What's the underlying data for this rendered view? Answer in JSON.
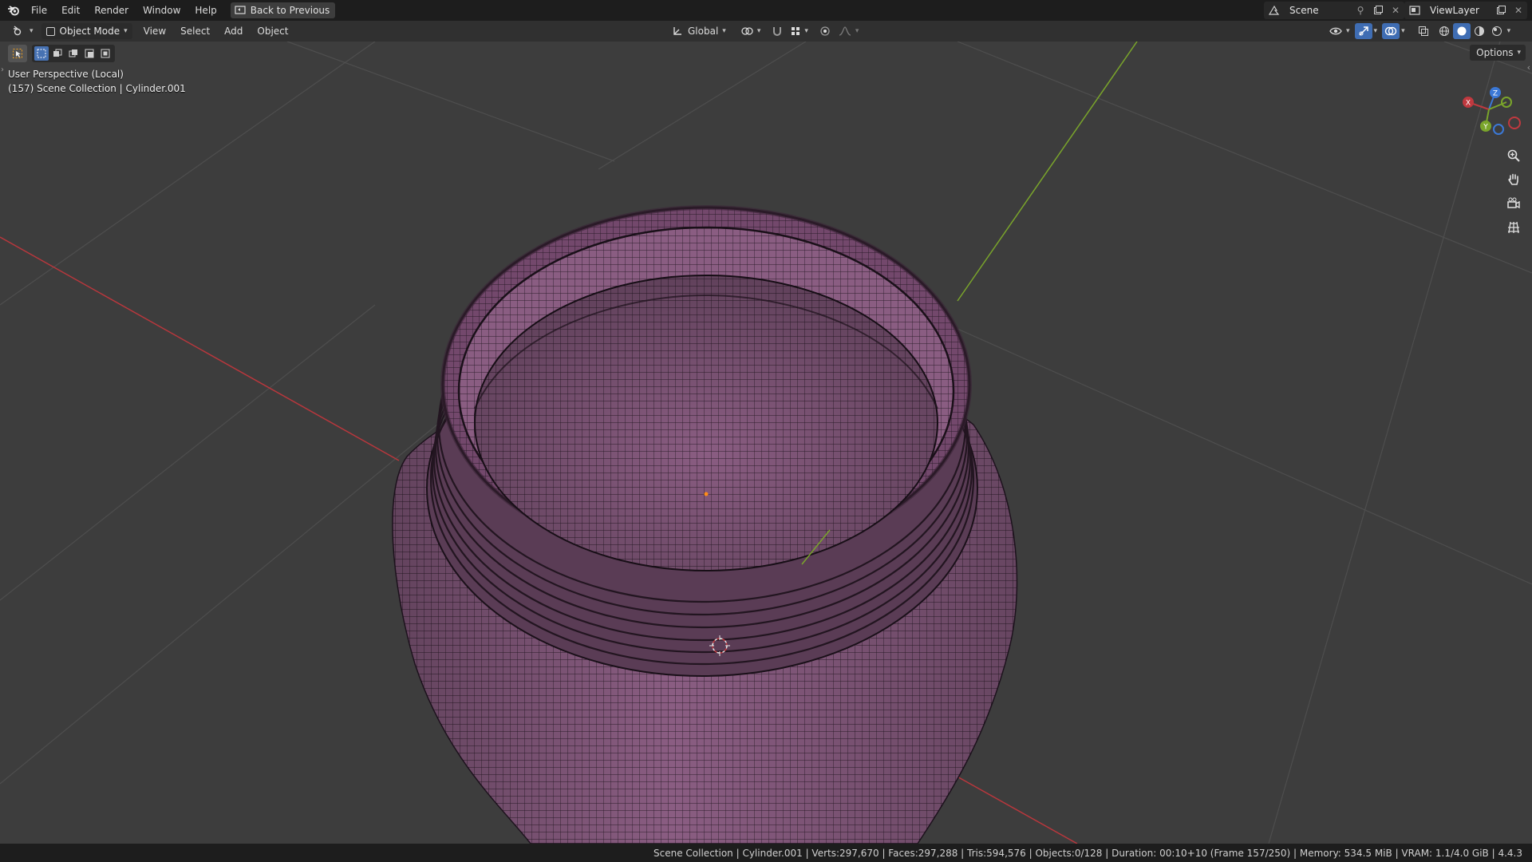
{
  "topbar": {
    "menus": [
      "File",
      "Edit",
      "Render",
      "Window",
      "Help"
    ],
    "back_button": "Back to Previous",
    "scene_name": "Scene",
    "view_layer": "ViewLayer"
  },
  "header": {
    "mode": "Object Mode",
    "menus": [
      "View",
      "Select",
      "Add",
      "Object"
    ],
    "transform_orientation": "Global"
  },
  "viewport": {
    "perspective_label": "User Perspective (Local)",
    "collection_label": "(157) Scene Collection | Cylinder.001",
    "options_label": "Options",
    "gizmo_axes": {
      "x": "X",
      "y": "Y",
      "z": "Z"
    }
  },
  "statusbar": {
    "text": "Scene Collection | Cylinder.001 | Verts:297,670 | Faces:297,288 | Tris:594,576 | Objects:0/128 | Duration: 00:10+10 (Frame 157/250) | Memory: 534.5 MiB | VRAM: 1.1/4.0 GiB | 4.4.3"
  },
  "colors": {
    "mesh": "#8a5d82",
    "axis_x": "#c0393f",
    "axis_y": "#7aa52b",
    "axis_z": "#3b78d6",
    "accent": "#4772b3"
  }
}
